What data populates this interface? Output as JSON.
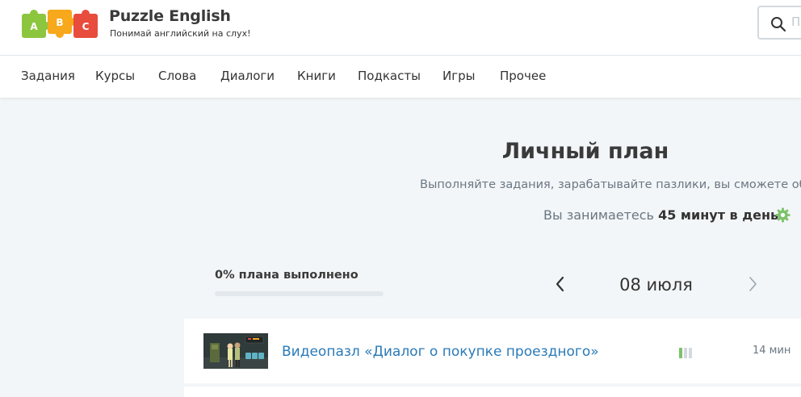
{
  "header": {
    "brand_name": "Puzzle English",
    "tagline": "Понимай английский на слух!",
    "logo_letters": [
      "A",
      "B",
      "C"
    ],
    "logo_colors": [
      "#8cc63f",
      "#f7a81b",
      "#e84c3d"
    ],
    "search_placeholder": "П"
  },
  "nav": {
    "items": [
      "Задания",
      "Курсы",
      "Слова",
      "Диалоги",
      "Книги",
      "Подкасты",
      "Игры",
      "Прочее"
    ]
  },
  "plan": {
    "title": "Личный план",
    "subtitle": "Выполняйте задания, зарабатывайте пазлики, вы сможете обм",
    "schedule_prefix": "Вы занимаетесь",
    "schedule_value": "45 минут в день",
    "progress_label": "0% плана выполнено",
    "progress_fraction": 0,
    "date": "08 июля"
  },
  "tasks": [
    {
      "title": "Видеопазл «Диалог о покупке проездного»",
      "duration": "14 мин",
      "difficulty_filled": 1,
      "difficulty_total": 3
    }
  ],
  "colors": {
    "accent_green": "#7cc36b",
    "link_blue": "#2a7ab7",
    "background": "#f3f6f8"
  },
  "icons": {
    "search": "search-icon",
    "settings": "gear-icon",
    "prev": "chevron-left-icon",
    "next": "chevron-right-icon"
  }
}
